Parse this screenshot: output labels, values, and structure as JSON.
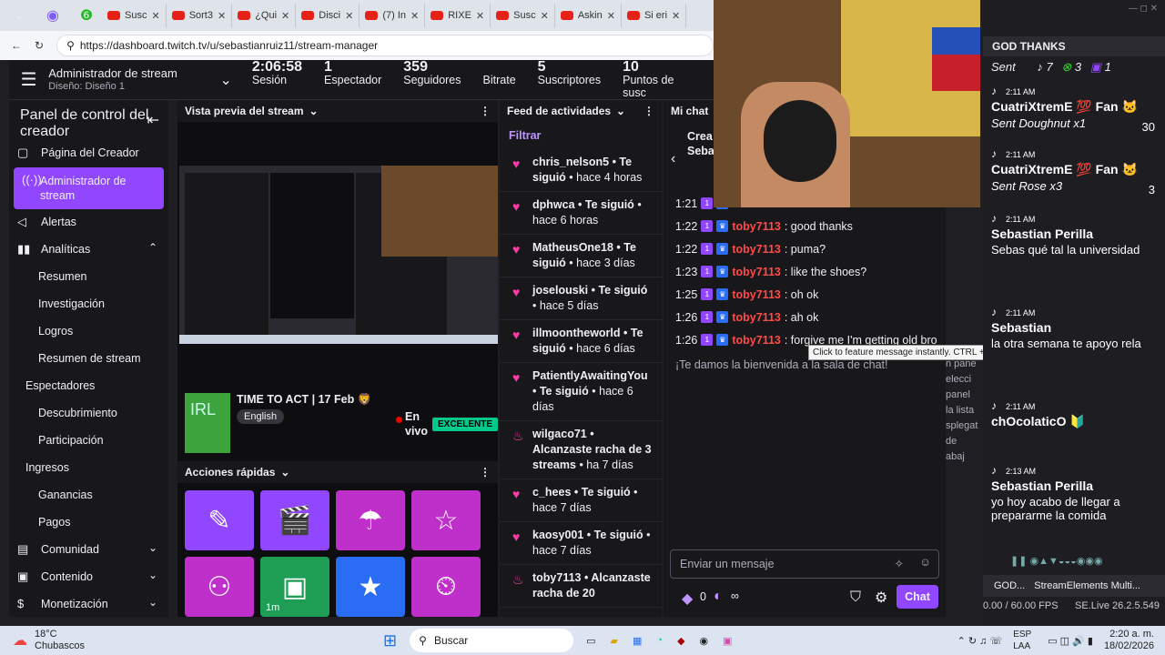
{
  "browser": {
    "tabs": [
      "Susc",
      "Sort3",
      "¿Qui",
      "Disci",
      "(7) In",
      "RIXE",
      "Susc",
      "Askin",
      "Si eri"
    ],
    "url": "https://dashboard.twitch.tv/u/sebastianruiz11/stream-manager"
  },
  "header": {
    "title": "Administrador de stream",
    "subtitle": "Diseño: Diseño 1",
    "stats": [
      {
        "n": "2:06:58",
        "l": "Sesión"
      },
      {
        "n": "1",
        "l": "Espectador"
      },
      {
        "n": "359",
        "l": "Seguidores"
      },
      {
        "n": "",
        "l": "Bitrate"
      },
      {
        "n": "5",
        "l": "Suscriptores"
      },
      {
        "n": "10",
        "l": "Puntos de susc"
      }
    ]
  },
  "sidebar": {
    "title": "Panel de control del creador",
    "items": [
      {
        "label": "Página del Creador",
        "type": "top",
        "icon": "▢"
      },
      {
        "label": "Administrador de stream",
        "type": "active",
        "icon": "((·))"
      },
      {
        "label": "Alertas",
        "type": "top",
        "icon": "◁"
      },
      {
        "label": "Analíticas",
        "type": "top",
        "icon": "▮▮"
      },
      {
        "label": "Resumen",
        "type": "sub"
      },
      {
        "label": "Investigación",
        "type": "sub"
      },
      {
        "label": "Logros",
        "type": "sub"
      },
      {
        "label": "Resumen de stream",
        "type": "sub"
      },
      {
        "label": "Espectadores",
        "type": "sec"
      },
      {
        "label": "Descubrimiento",
        "type": "sub"
      },
      {
        "label": "Participación",
        "type": "sub"
      },
      {
        "label": "Ingresos",
        "type": "sec"
      },
      {
        "label": "Ganancias",
        "type": "sub"
      },
      {
        "label": "Pagos",
        "type": "sub"
      },
      {
        "label": "Comunidad",
        "type": "top",
        "icon": "▤"
      },
      {
        "label": "Contenido",
        "type": "top",
        "icon": "▣"
      },
      {
        "label": "Monetización",
        "type": "top",
        "icon": "$"
      }
    ]
  },
  "preview": {
    "title": "Vista previa del stream",
    "stream_title": "TIME TO ACT | 17 Feb 🦁",
    "language": "English",
    "live": "En vivo",
    "quality": "EXCELENTE",
    "quick_actions": "Acciones rápidas",
    "quick_timer": "1m"
  },
  "feed": {
    "title": "Feed de actividades",
    "filter": "Filtrar",
    "items": [
      {
        "user": "chris_nelson5",
        "text": "• Te siguió",
        "time": "• hace 4 horas"
      },
      {
        "user": "dphwca",
        "text": "• Te siguió",
        "time": "• hace 6 horas"
      },
      {
        "user": "MatheusOne18",
        "text": "• Te siguió",
        "time": "• hace 3 días"
      },
      {
        "user": "joselouski",
        "text": "• Te siguió",
        "time": "• hace 5 días"
      },
      {
        "user": "illmoontheworld",
        "text": "• Te siguió",
        "time": "• hace 6 días"
      },
      {
        "user": "PatientlyAwaitingYou",
        "text": "• Te siguió",
        "time": "• hace 6 días"
      },
      {
        "user": "wilgaco71",
        "text": "• Alcanzaste racha de 3 streams",
        "time": "• ha 7 días"
      },
      {
        "user": "c_hees",
        "text": "• Te siguió",
        "time": "• hace 7 días"
      },
      {
        "user": "kaosy001",
        "text": "• Te siguió",
        "time": "• hace 7 días"
      },
      {
        "user": "toby7113",
        "text": "• Alcanzaste racha de 20",
        "time": ""
      }
    ]
  },
  "chat": {
    "title": "Mi chat",
    "top_label": "Crea Seba",
    "messages": [
      {
        "t": "1:21",
        "u": "",
        "m": ""
      },
      {
        "t": "1:22",
        "u": "toby7113",
        "m": ": good thanks"
      },
      {
        "t": "1:22",
        "u": "toby7113",
        "m": ": puma?"
      },
      {
        "t": "1:23",
        "u": "toby7113",
        "m": ": like the shoes?"
      },
      {
        "t": "1:25",
        "u": "toby7113",
        "m": ": oh ok"
      },
      {
        "t": "1:26",
        "u": "toby7113",
        "m": ": ah ok"
      },
      {
        "t": "1:26",
        "u": "toby7113",
        "m": ": forgive me I'm getting old bro"
      }
    ],
    "welcome": "¡Te damos la bienvenida a la sala de chat!",
    "placeholder": "Enviar un mensaje",
    "points": "0",
    "infinity": "∞",
    "send": "Chat",
    "side_text": [
      "n pane",
      "elecci",
      "panel",
      "la lista",
      "splegat",
      "de abaj"
    ]
  },
  "tiktok": {
    "header": "GOD THANKS",
    "top_row": "Sent",
    "top_numbers": [
      "7",
      "3",
      "1"
    ],
    "tooltip": "Click to feature message instantly. CTRL + Click to add to the queue. Alt + Click to Pin.",
    "messages": [
      {
        "time": "2:11 AM",
        "user": "CuatriXtremE 💯 Fan 🐱",
        "sub": "Sent Doughnut x1",
        "count": "30"
      },
      {
        "time": "2:11 AM",
        "user": "CuatriXtremE 💯 Fan 🐱",
        "sub": "Sent Rose x3",
        "count": "3"
      },
      {
        "time": "2:11 AM",
        "user": "Sebastian Perilla",
        "sub": "Sebas qué tal la universidad",
        "count": ""
      },
      {
        "time": "2:11 AM",
        "user": "Sebastian",
        "sub": "la otra semana te apoyo rela",
        "count": ""
      },
      {
        "time": "2:11 AM",
        "user": "chOcolaticO 🔰",
        "sub": "",
        "count": ""
      },
      {
        "time": "2:13 AM",
        "user": "Sebastian Perilla",
        "sub": "yo hoy acabo de llegar a prepararme la comida",
        "count": ""
      }
    ],
    "tabs": [
      "GOD...",
      "StreamElements Multi..."
    ],
    "fps": "0.00 / 60.00 FPS",
    "version": "SE.Live 26.2.5.549"
  },
  "taskbar": {
    "temp": "18°C",
    "weather": "Chubascos",
    "search": "Buscar",
    "lang": "ESP LAA",
    "time": "2:20 a. m.",
    "date": "18/02/2026"
  }
}
